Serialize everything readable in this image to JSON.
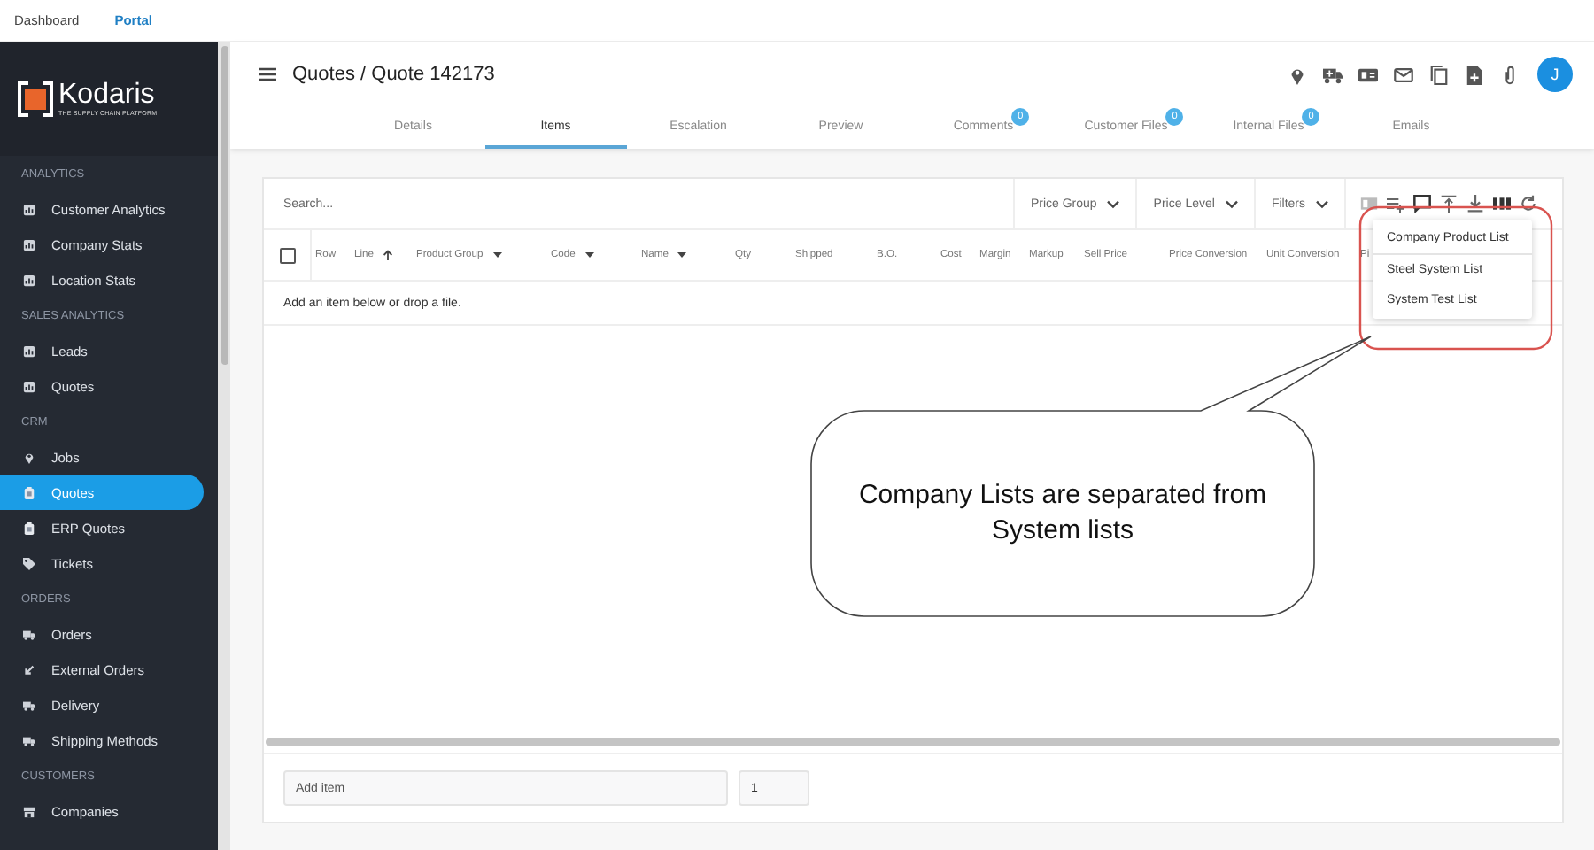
{
  "top_nav": [
    {
      "label": "Dashboard",
      "selected": false
    },
    {
      "label": "Portal",
      "selected": true
    }
  ],
  "sidebar": {
    "logo": {
      "name": "Kodaris",
      "tagline": "THE SUPPLY CHAIN PLATFORM"
    },
    "sections": [
      {
        "title": "ANALYTICS",
        "items": [
          {
            "label": "Customer Analytics",
            "kind": "chart",
            "selected": false
          },
          {
            "label": "Company Stats",
            "kind": "chart",
            "selected": false
          },
          {
            "label": "Location Stats",
            "kind": "chart",
            "selected": false
          }
        ]
      },
      {
        "title": "SALES ANALYTICS",
        "items": [
          {
            "label": "Leads",
            "kind": "chart",
            "selected": false
          },
          {
            "label": "Quotes",
            "kind": "chart",
            "selected": false
          }
        ]
      },
      {
        "title": "CRM",
        "items": [
          {
            "label": "Jobs",
            "kind": "pin",
            "selected": false
          },
          {
            "label": "Quotes",
            "kind": "clipboard",
            "selected": true
          },
          {
            "label": "ERP Quotes",
            "kind": "clipboard",
            "selected": false
          },
          {
            "label": "Tickets",
            "kind": "tag",
            "selected": false
          }
        ]
      },
      {
        "title": "ORDERS",
        "items": [
          {
            "label": "Orders",
            "kind": "truck",
            "selected": false
          },
          {
            "label": "External Orders",
            "kind": "arrow",
            "selected": false
          },
          {
            "label": "Delivery",
            "kind": "truck",
            "selected": false
          },
          {
            "label": "Shipping Methods",
            "kind": "truck",
            "selected": false
          }
        ]
      },
      {
        "title": "CUSTOMERS",
        "items": [
          {
            "label": "Companies",
            "kind": "store",
            "selected": false
          }
        ]
      }
    ]
  },
  "header": {
    "title": "Quotes / Quote 142173",
    "avatar": "J"
  },
  "tabs": [
    {
      "label": "Details",
      "selected": false
    },
    {
      "label": "Items",
      "selected": true
    },
    {
      "label": "Escalation",
      "selected": false
    },
    {
      "label": "Preview",
      "selected": false
    },
    {
      "label": "Comments",
      "badge": "0",
      "selected": false
    },
    {
      "label": "Customer Files",
      "badge": "0",
      "selected": false
    },
    {
      "label": "Internal Files",
      "badge": "0",
      "selected": false
    },
    {
      "label": "Emails",
      "selected": false
    }
  ],
  "grid": {
    "search_placeholder": "Search...",
    "dropdowns": [
      "Price Group",
      "Price Level",
      "Filters"
    ],
    "select_all_checked": false,
    "columns": [
      {
        "label": "Row",
        "kind": "plain"
      },
      {
        "label": "Line",
        "kind": "sorted"
      },
      {
        "label": "Product Group",
        "kind": "menu"
      },
      {
        "label": "Code",
        "kind": "menu"
      },
      {
        "label": "Name",
        "kind": "menu"
      },
      {
        "label": "Qty",
        "kind": "plain"
      },
      {
        "label": "Shipped",
        "kind": "plain"
      },
      {
        "label": "B.O.",
        "kind": "plain"
      },
      {
        "label": "Cost",
        "kind": "plain"
      },
      {
        "label": "Margin",
        "kind": "plain"
      },
      {
        "label": "Markup",
        "kind": "plain"
      },
      {
        "label": "Sell Price",
        "kind": "plain"
      },
      {
        "label": "Price Conversion",
        "kind": "plain"
      },
      {
        "label": "Unit Conversion",
        "kind": "plain"
      },
      {
        "label": "Pi",
        "kind": "plain"
      }
    ],
    "empty_message": "Add an item below or drop a file."
  },
  "menu": {
    "groups": [
      {
        "items": [
          "Company Product List"
        ]
      },
      {
        "items": [
          "Steel System List",
          "System Test List"
        ]
      }
    ]
  },
  "footer": {
    "item_placeholder": "Add item",
    "quantity": "1"
  },
  "callout": {
    "text": "Company Lists are separated from System lists"
  }
}
